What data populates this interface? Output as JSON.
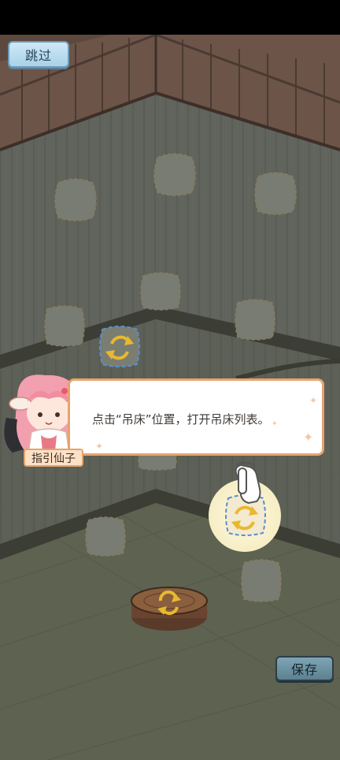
{
  "top_bar": {
    "skip_label": "跳过"
  },
  "guide": {
    "speaker_name": "指引仙子",
    "message": "点击“吊床”位置，打开吊床列表。"
  },
  "bottom_bar": {
    "save_label": "保存"
  },
  "colors": {
    "skip_button": "#bfe0f2",
    "save_button": "#6f95a4",
    "dialog_border": "#e6a46c",
    "nameplate_bg": "#fde1c6",
    "wall": "#6b6f66",
    "floor": "#5f6150",
    "roof_wood": "#6a5347"
  },
  "icons": {
    "swap": "swap-arrows-icon",
    "hand": "pointing-hand-icon"
  }
}
